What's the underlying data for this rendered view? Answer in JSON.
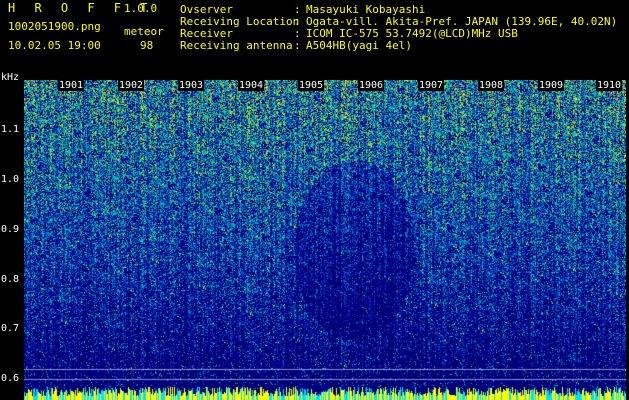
{
  "header": {
    "app_name": "H R O F F T",
    "version": "1.0.0",
    "file_name": "1002051900.png",
    "mode": "meteor",
    "timestamp": "10.02.05 19:00",
    "count": "98"
  },
  "metadata": [
    {
      "label": "Ovserver",
      "value": "Masayuki Kobayashi"
    },
    {
      "label": "Receiving Location",
      "value": "Ogata-vill. Akita-Pref. JAPAN (139.96E, 40.02N)"
    },
    {
      "label": "Receiver",
      "value": "ICOM IC-575 53.7492(@LCD)MHz USB"
    },
    {
      "label": "Receiving antenna",
      "value": "A504HB(yagi 4el)"
    }
  ],
  "colon": ":",
  "y_axis": {
    "unit": "kHz",
    "ticks": [
      "1.1",
      "1.0",
      "0.9",
      "0.8",
      "0.7",
      "0.6"
    ]
  },
  "time_axis": {
    "labels": [
      "1901",
      "1902",
      "1903",
      "1904",
      "1905",
      "1906",
      "1907",
      "1908",
      "1909",
      "1910"
    ]
  },
  "colors": {
    "background": "#000000",
    "title_text": "#ffff00",
    "metadata_text": "#00d8ff",
    "axis_text": "#ffffff"
  }
}
